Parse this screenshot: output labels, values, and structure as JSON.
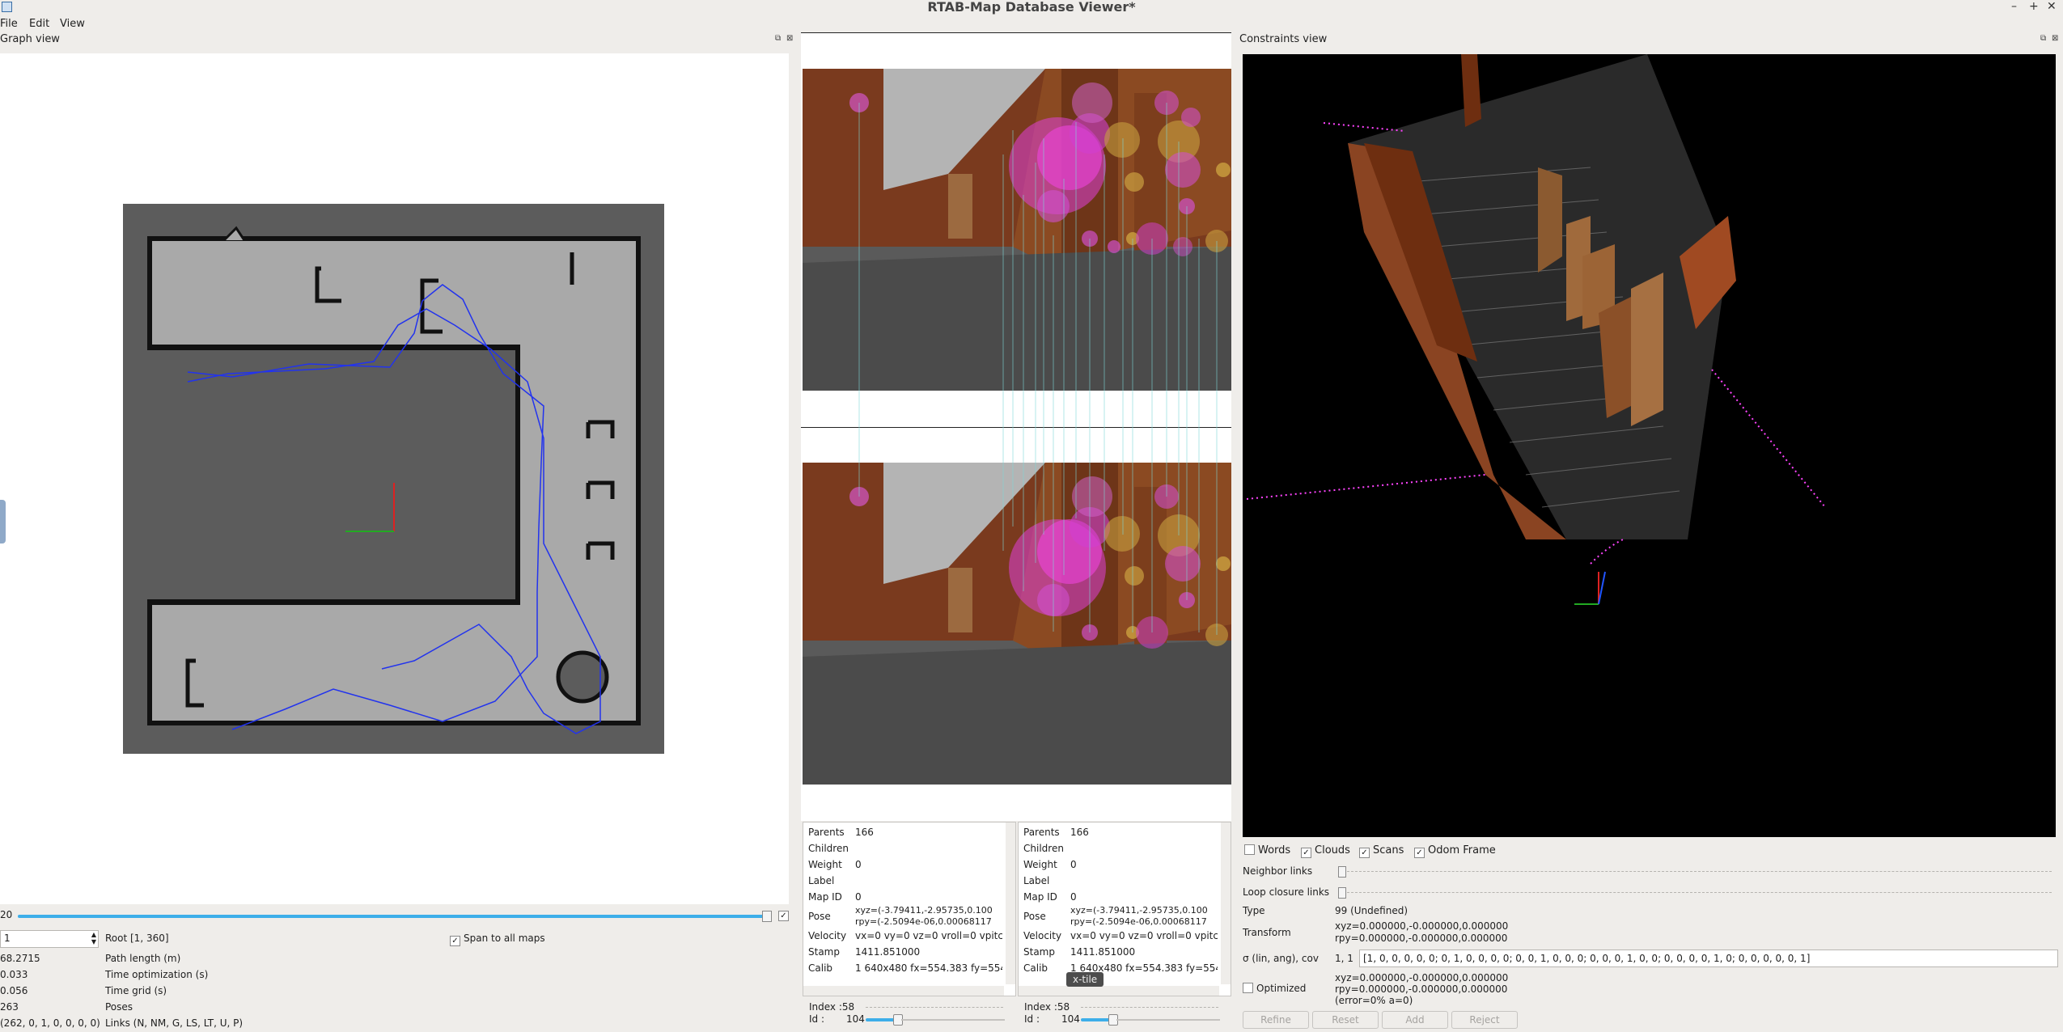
{
  "window": {
    "title": "RTAB-Map Database Viewer*"
  },
  "menu": [
    "File",
    "Edit",
    "View"
  ],
  "graph_view": {
    "title": "Graph view",
    "slider_value": "20",
    "spin_value": "1",
    "root_label": "Root [1, 360]",
    "span_label": "Span to all maps",
    "stats": [
      {
        "value": "68.2715",
        "label": "Path length (m)"
      },
      {
        "value": "0.033",
        "label": "Time optimization (s)"
      },
      {
        "value": "0.056",
        "label": "Time grid (s)"
      },
      {
        "value": "263",
        "label": "Poses"
      },
      {
        "value": "(262, 0, 1, 0, 0, 0, 0)",
        "label": "Links (N, NM, G, LS, LT, U, P)"
      }
    ]
  },
  "node_left": {
    "rows": [
      {
        "k": "Parents",
        "v": "166"
      },
      {
        "k": "Children",
        "v": ""
      },
      {
        "k": "Weight",
        "v": "0"
      },
      {
        "k": "Label",
        "v": ""
      },
      {
        "k": "Map ID",
        "v": "0"
      },
      {
        "k": "Pose",
        "v": "xyz=(-3.79411,-2.95735,0.100\nrpy=(-2.5094e-06,0.00068117"
      },
      {
        "k": "Velocity",
        "v": "vx=0 vy=0 vz=0 vroll=0 vpitc"
      },
      {
        "k": "Stamp",
        "v": "1411.851000"
      },
      {
        "k": "Calib",
        "v": "1 640x480 fx=554.383 fy=554"
      }
    ],
    "index_label": "Index :58",
    "id_label": "Id :",
    "id_value": "104"
  },
  "node_right": {
    "rows": [
      {
        "k": "Parents",
        "v": "166"
      },
      {
        "k": "Children",
        "v": ""
      },
      {
        "k": "Weight",
        "v": "0"
      },
      {
        "k": "Label",
        "v": ""
      },
      {
        "k": "Map ID",
        "v": "0"
      },
      {
        "k": "Pose",
        "v": "xyz=(-3.79411,-2.95735,0.100\nrpy=(-2.5094e-06,0.00068117"
      },
      {
        "k": "Velocity",
        "v": "vx=0 vy=0 vz=0 vroll=0 vpitc"
      },
      {
        "k": "Stamp",
        "v": "1411.851000"
      },
      {
        "k": "Calib",
        "v": "1 640x480 fx=554.383 fy=554"
      }
    ],
    "index_label": "Index :58",
    "id_label": "Id :",
    "id_value": "104",
    "tooltip": "x-tile"
  },
  "constraints": {
    "title": "Constraints view",
    "checkboxes": [
      {
        "label": "Words",
        "checked": false
      },
      {
        "label": "Clouds",
        "checked": true
      },
      {
        "label": "Scans",
        "checked": true
      },
      {
        "label": "Odom Frame",
        "checked": true
      }
    ],
    "neighbor_links": "Neighbor links",
    "loop_closure_links": "Loop closure links",
    "type_label": "Type",
    "type_value": "99 (Undefined)",
    "transform_label": "Transform",
    "transform_value1": "xyz=0.000000,-0.000000,0.000000",
    "transform_value2": "rpy=0.000000,-0.000000,0.000000",
    "cov_label": "σ (lin, ang), cov",
    "cov_small": "1, 1",
    "cov_value": "[1, 0, 0, 0, 0, 0;  0, 1, 0, 0, 0, 0;  0, 0, 1, 0, 0, 0;  0, 0, 0, 1, 0, 0;  0, 0, 0, 0, 1, 0;  0, 0, 0, 0, 0, 1]",
    "optimized_label": "Optimized",
    "opt_value1": "xyz=0.000000,-0.000000,0.000000",
    "opt_value2": "rpy=0.000000,-0.000000,0.000000",
    "opt_value3": "(error=0% a=0)",
    "buttons": [
      "Refine",
      "Reset",
      "Add",
      "Reject"
    ]
  }
}
